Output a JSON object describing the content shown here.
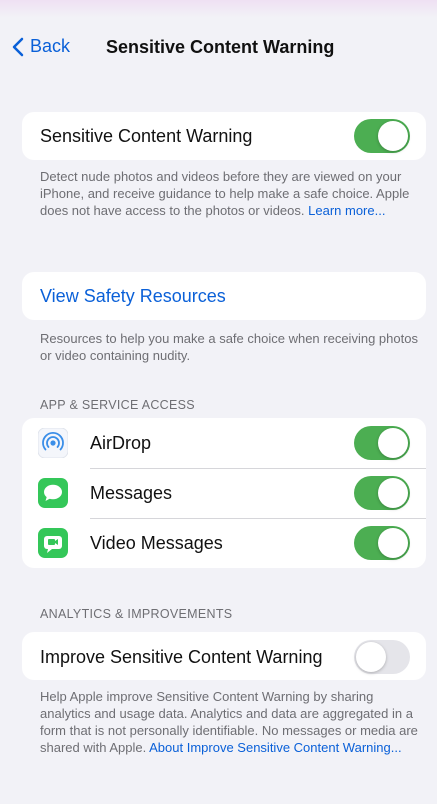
{
  "nav": {
    "back_label": "Back",
    "title": "Sensitive Content Warning"
  },
  "main_toggle": {
    "label": "Sensitive Content Warning",
    "enabled": true,
    "description": "Detect nude photos and videos before they are viewed on your iPhone, and receive guidance to help make a safe choice. Apple does not have access to the photos or videos.",
    "learn_more": "Learn more..."
  },
  "safety": {
    "link_label": "View Safety Resources",
    "description": "Resources to help you make a safe choice when receiving photos or video containing nudity."
  },
  "app_access": {
    "header": "APP & SERVICE ACCESS",
    "items": [
      {
        "label": "AirDrop",
        "icon": "airdrop-icon",
        "enabled": true
      },
      {
        "label": "Messages",
        "icon": "messages-icon",
        "enabled": true
      },
      {
        "label": "Video Messages",
        "icon": "video-messages-icon",
        "enabled": true
      }
    ]
  },
  "analytics": {
    "header": "ANALYTICS & IMPROVEMENTS",
    "label": "Improve Sensitive Content Warning",
    "enabled": false,
    "description": "Help Apple improve Sensitive Content Warning by sharing analytics and usage data. Analytics and data are aggregated in a form that is not personally identifiable. No messages or media are shared with Apple.",
    "link": "About Improve Sensitive Content Warning..."
  },
  "colors": {
    "accent": "#0a60d8",
    "toggle_on": "#4cae52",
    "toggle_off": "#e5e5ea",
    "background": "#f2f2f7"
  }
}
